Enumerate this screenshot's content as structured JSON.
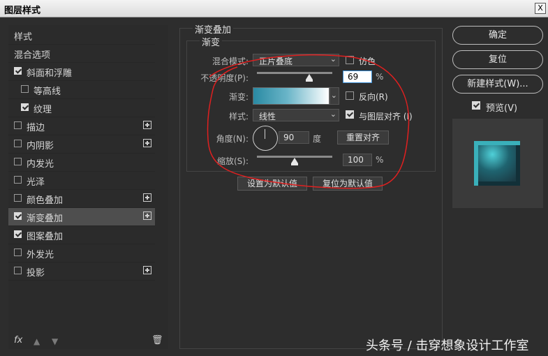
{
  "window": {
    "title": "图层样式",
    "close_label": "X"
  },
  "left_panel": {
    "items": [
      {
        "label": "样式",
        "checkbox": false,
        "checked": false,
        "plus": false,
        "active": false,
        "indent": false
      },
      {
        "label": "混合选项",
        "checkbox": false,
        "checked": false,
        "plus": false,
        "active": false,
        "indent": false
      },
      {
        "label": "斜面和浮雕",
        "checkbox": true,
        "checked": true,
        "plus": false,
        "active": false,
        "indent": false
      },
      {
        "label": "等高线",
        "checkbox": true,
        "checked": false,
        "plus": false,
        "active": false,
        "indent": true
      },
      {
        "label": "纹理",
        "checkbox": true,
        "checked": true,
        "plus": false,
        "active": false,
        "indent": true
      },
      {
        "label": "描边",
        "checkbox": true,
        "checked": false,
        "plus": true,
        "active": false,
        "indent": false
      },
      {
        "label": "内阴影",
        "checkbox": true,
        "checked": false,
        "plus": true,
        "active": false,
        "indent": false
      },
      {
        "label": "内发光",
        "checkbox": true,
        "checked": false,
        "plus": false,
        "active": false,
        "indent": false
      },
      {
        "label": "光泽",
        "checkbox": true,
        "checked": false,
        "plus": false,
        "active": false,
        "indent": false
      },
      {
        "label": "颜色叠加",
        "checkbox": true,
        "checked": false,
        "plus": true,
        "active": false,
        "indent": false
      },
      {
        "label": "渐变叠加",
        "checkbox": true,
        "checked": true,
        "plus": true,
        "active": true,
        "indent": false
      },
      {
        "label": "图案叠加",
        "checkbox": true,
        "checked": true,
        "plus": false,
        "active": false,
        "indent": false
      },
      {
        "label": "外发光",
        "checkbox": true,
        "checked": false,
        "plus": false,
        "active": false,
        "indent": false
      },
      {
        "label": "投影",
        "checkbox": true,
        "checked": false,
        "plus": true,
        "active": false,
        "indent": false
      }
    ],
    "footer": {
      "fx": "fx",
      "up_icon": "arrow-up-icon",
      "down_icon": "arrow-down-icon",
      "trash_icon": "trash-icon"
    }
  },
  "gradient_overlay": {
    "section_title": "渐变叠加",
    "group_title": "渐变",
    "blend_mode_label": "混合模式:",
    "blend_mode_value": "正片叠底",
    "dither_label": "仿色",
    "dither_checked": false,
    "opacity_label": "不透明度(P):",
    "opacity_value": "69",
    "opacity_unit": "%",
    "opacity_level": 0.69,
    "gradient_label": "渐变:",
    "reverse_label": "反向(R)",
    "reverse_checked": false,
    "style_label": "样式:",
    "style_value": "线性",
    "align_label": "与图层对齐 (I)",
    "align_checked": true,
    "angle_label": "角度(N):",
    "angle_value": "90",
    "angle_unit": "度",
    "reset_align_label": "重置对齐",
    "scale_label": "缩放(S):",
    "scale_value": "100",
    "scale_unit": "%",
    "scale_level": 0.5,
    "set_default_label": "设置为默认值",
    "reset_default_label": "复位为默认值",
    "gradient_colors": [
      "#2a8aa3",
      "#6ab5c8",
      "#ffffff"
    ]
  },
  "right_panel": {
    "ok_label": "确定",
    "reset_label": "复位",
    "new_style_label": "新建样式(W)...",
    "preview_label": "预览(V)",
    "preview_checked": true
  },
  "watermark": "头条号 / 击穿想象设计工作室",
  "annotation_color": "#e02020"
}
